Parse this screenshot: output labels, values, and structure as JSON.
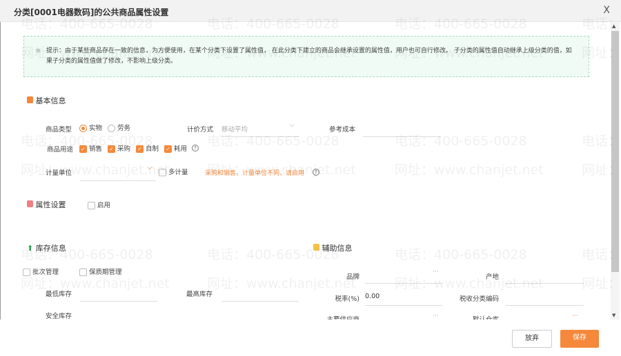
{
  "dialog": {
    "title": "分类[0001电器数码]的公共商品属性设置",
    "close_label": "X"
  },
  "tip": {
    "text": "提示：由于某些商品存在一致的信息，为方便使用，在某个分类下设置了属性值， 在此分类下建立的商品会继承设置的属性值，用户也可自行修改。 子分类的属性值自动继承上级分类的值，如果子分类的属性值做了修改，不影响上级分类。"
  },
  "basic": {
    "title": "基本信息",
    "icon_color": "#f5883a",
    "type_label": "商品类型",
    "type_options": [
      "实物",
      "劳务"
    ],
    "type_selected": "实物",
    "pricing_label": "计价方式",
    "pricing_value": "移动平均",
    "ref_cost_label": "参考成本",
    "usage_label": "商品用途",
    "usage_options": [
      "销售",
      "采购",
      "自制",
      "耗用"
    ],
    "usage_checked": [
      true,
      true,
      true,
      true
    ],
    "unit_label": "计量单位",
    "multi_unit_label": "多计量",
    "multi_unit_hint": "采购和销售，计量单位不同，请启用"
  },
  "attr": {
    "title": "属性设置",
    "enable_label": "启用",
    "icon_color": "#f08080"
  },
  "stock": {
    "title": "库存信息",
    "icon_color": "#2e9e4f",
    "batch_label": "批次管理",
    "shelf_label": "保质期管理",
    "min_label": "最低库存",
    "max_label": "最高库存",
    "safe_label": "安全库存"
  },
  "aux": {
    "title": "辅助信息",
    "icon_color": "#f5c04a",
    "brand_label": "品牌",
    "origin_label": "产地",
    "tax_label": "税率(%)",
    "tax_value": "0.00",
    "tax_code_label": "税收分类编码",
    "supplier_label": "主要供应商",
    "warehouse_label": "默认仓库",
    "more": "···"
  },
  "footer": {
    "cancel_label": "放弃",
    "save_label": "保存",
    "accent": "#f5883a"
  },
  "watermark": {
    "phone": "电话：400-665-0028",
    "site": "网址：www.chanjet.net"
  }
}
